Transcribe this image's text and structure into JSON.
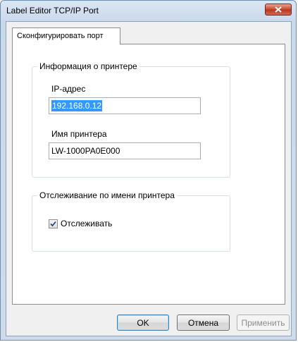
{
  "window": {
    "title": "Label Editor TCP/IP Port"
  },
  "tabs": [
    {
      "label": "Сконфигурировать порт"
    }
  ],
  "printer_info": {
    "group_title": "Информация о принтере",
    "ip_label": "IP-адрес",
    "ip_value": "192.168.0.12",
    "name_label": "Имя принтера",
    "name_value": "LW-1000PA0E000"
  },
  "tracking": {
    "group_title": "Отслеживание по имени принтера",
    "checkbox_label": "Отслеживать",
    "checked": true
  },
  "buttons": {
    "ok": "OK",
    "cancel": "Отмена",
    "apply": "Применить"
  },
  "icons": {
    "close": "close-icon",
    "check": "checkmark-icon"
  }
}
